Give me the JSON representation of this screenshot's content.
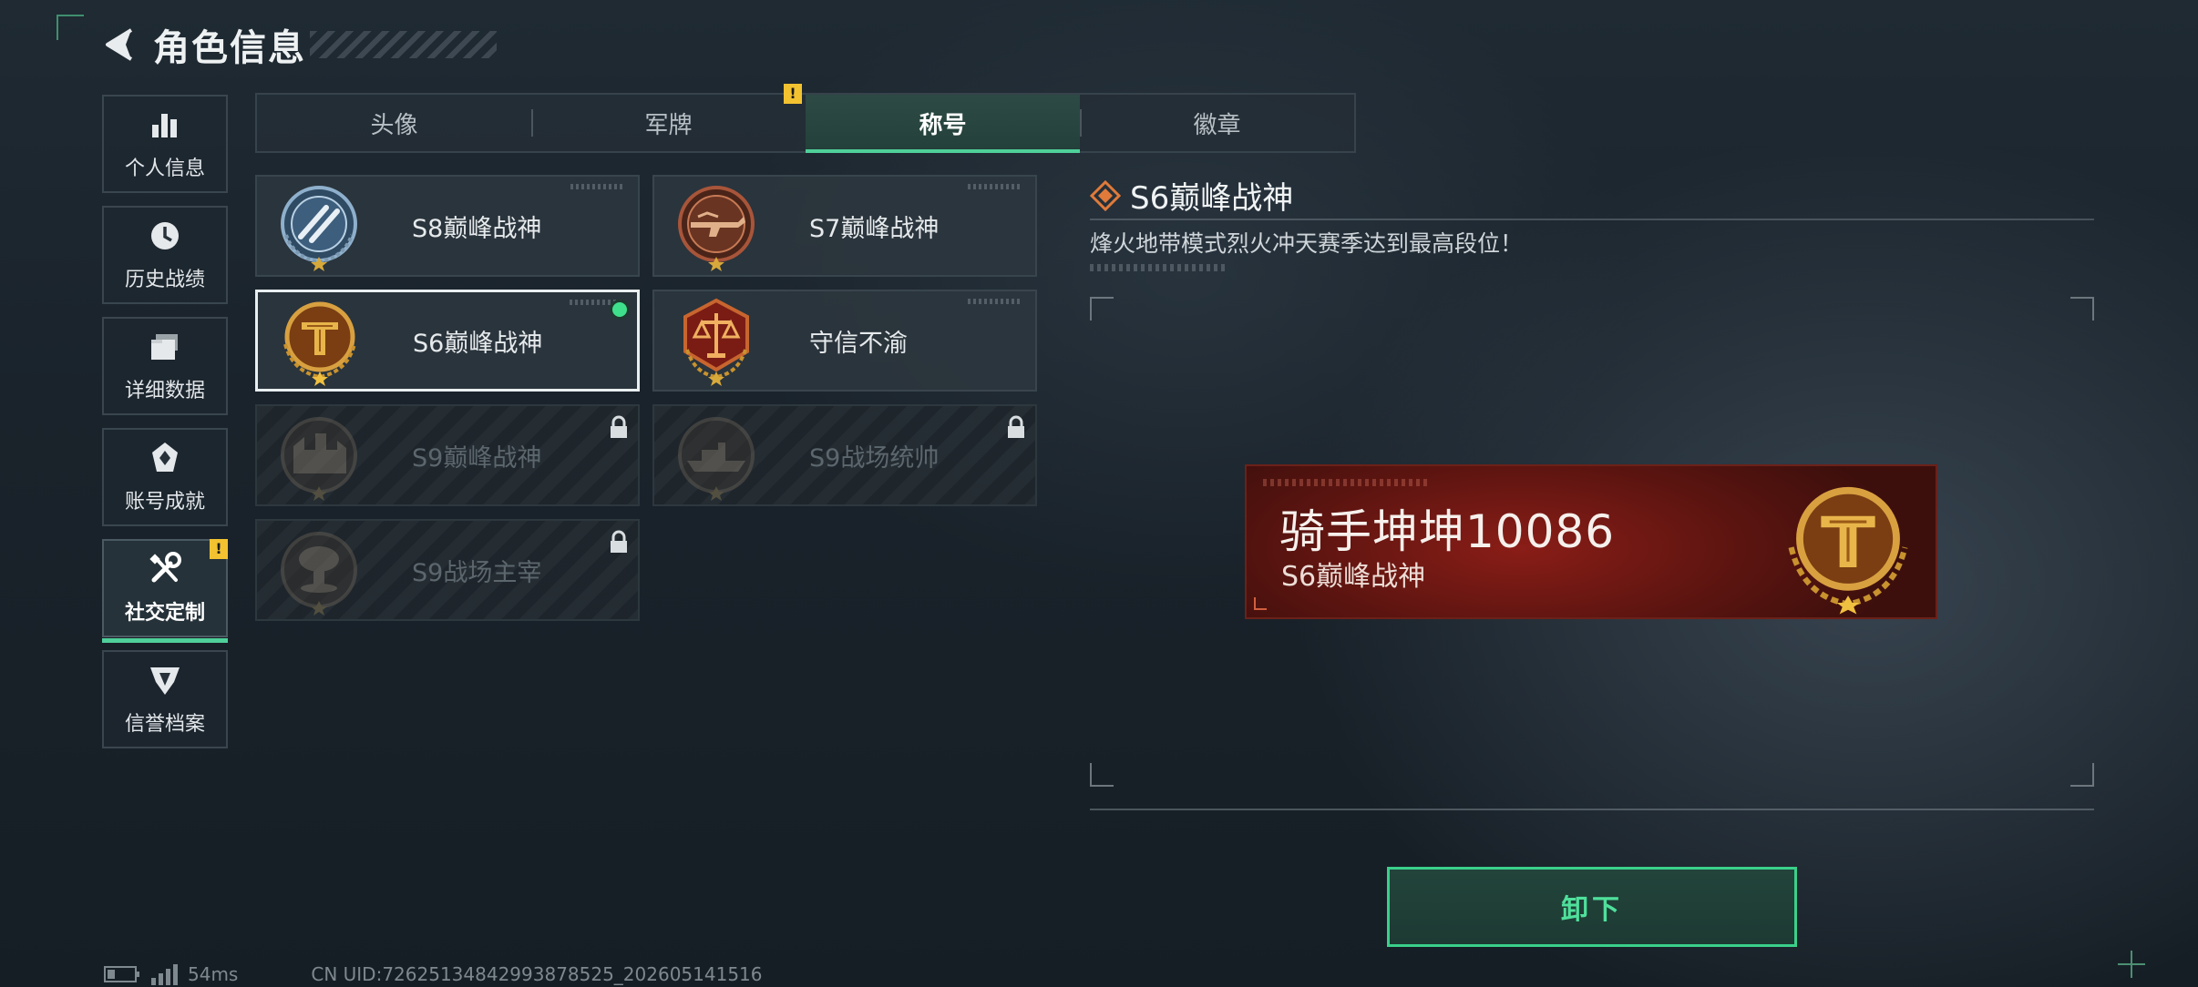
{
  "header": {
    "title": "角色信息"
  },
  "sidebar": {
    "items": [
      {
        "label": "个人信息",
        "icon": "bar-chart-icon",
        "active": false
      },
      {
        "label": "历史战绩",
        "icon": "history-clock-icon",
        "active": false
      },
      {
        "label": "详细数据",
        "icon": "folder-stack-icon",
        "active": false
      },
      {
        "label": "账号成就",
        "icon": "achievement-icon",
        "active": false
      },
      {
        "label": "社交定制",
        "icon": "tools-icon",
        "active": true,
        "warning": "!"
      },
      {
        "label": "信誉档案",
        "icon": "credit-shield-icon",
        "active": false
      }
    ]
  },
  "tabs": [
    {
      "label": "头像",
      "active": false
    },
    {
      "label": "军牌",
      "active": false,
      "warning": "!"
    },
    {
      "label": "称号",
      "active": true
    },
    {
      "label": "徽章",
      "active": false
    }
  ],
  "titles": [
    {
      "label": "S8巅峰战神",
      "medal": "blue-emblem",
      "state": "unlocked"
    },
    {
      "label": "S7巅峰战神",
      "medal": "bronze-gun-emblem",
      "state": "unlocked"
    },
    {
      "label": "S6巅峰战神",
      "medal": "gold-t-emblem",
      "state": "equipped"
    },
    {
      "label": "守信不渝",
      "medal": "scales-emblem",
      "state": "unlocked"
    },
    {
      "label": "S9巅峰战神",
      "medal": "fortress-emblem",
      "state": "locked"
    },
    {
      "label": "S9战场统帅",
      "medal": "warship-emblem",
      "state": "locked"
    },
    {
      "label": "S9战场主宰",
      "medal": "mushroom-cloud-emblem",
      "state": "locked"
    }
  ],
  "detail": {
    "title": "S6巅峰战神",
    "description": "烽火地带模式烈火冲天赛季达到最高段位！",
    "preview": {
      "player_name": "骑手坤坤10086",
      "title_text": "S6巅峰战神"
    }
  },
  "actions": {
    "unequip_label": "卸下"
  },
  "status": {
    "ping": "54ms",
    "uid": "CN UID:7262513484299387852​5_202605141516"
  },
  "colors": {
    "accent": "#4fd09a",
    "warning": "#f2c230",
    "banner": "#7a1a14",
    "gold": "#c8922e"
  }
}
